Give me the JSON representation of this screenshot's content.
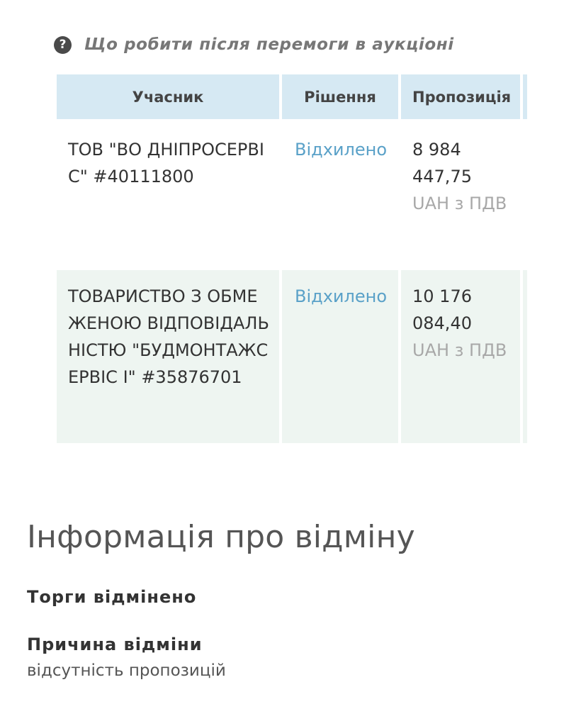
{
  "help_link": {
    "icon": "question-circle-icon",
    "label": "Що робити після перемоги в аукціоні"
  },
  "table": {
    "headers": {
      "participant": "Учасник",
      "decision": "Рішення",
      "offer": "Пропозиція"
    },
    "rows": [
      {
        "participant": "ТОВ \"ВО ДНІПРОСЕРВІС\" #40111800",
        "decision": "Відхилено",
        "amount": "8 984 447,75",
        "currency": "UAH з ПДВ"
      },
      {
        "participant": "ТОВАРИСТВО З ОБМЕЖЕНОЮ ВІДПОВІДАЛЬНІСТЮ \"БУДМОНТАЖСЕРВІС І\" #35876701",
        "decision": "Відхилено",
        "amount": "10 176 084,40",
        "currency": "UAH з ПДВ"
      }
    ]
  },
  "cancellation": {
    "title": "Інформація про відміну",
    "status": "Торги відмінено",
    "reason_label": "Причина відміни",
    "reason_value": "відсутність пропозицій"
  },
  "colors": {
    "header_bg": "#d6e9f3",
    "row_alt_bg": "#eef5f1",
    "link": "#5aa1c8"
  }
}
